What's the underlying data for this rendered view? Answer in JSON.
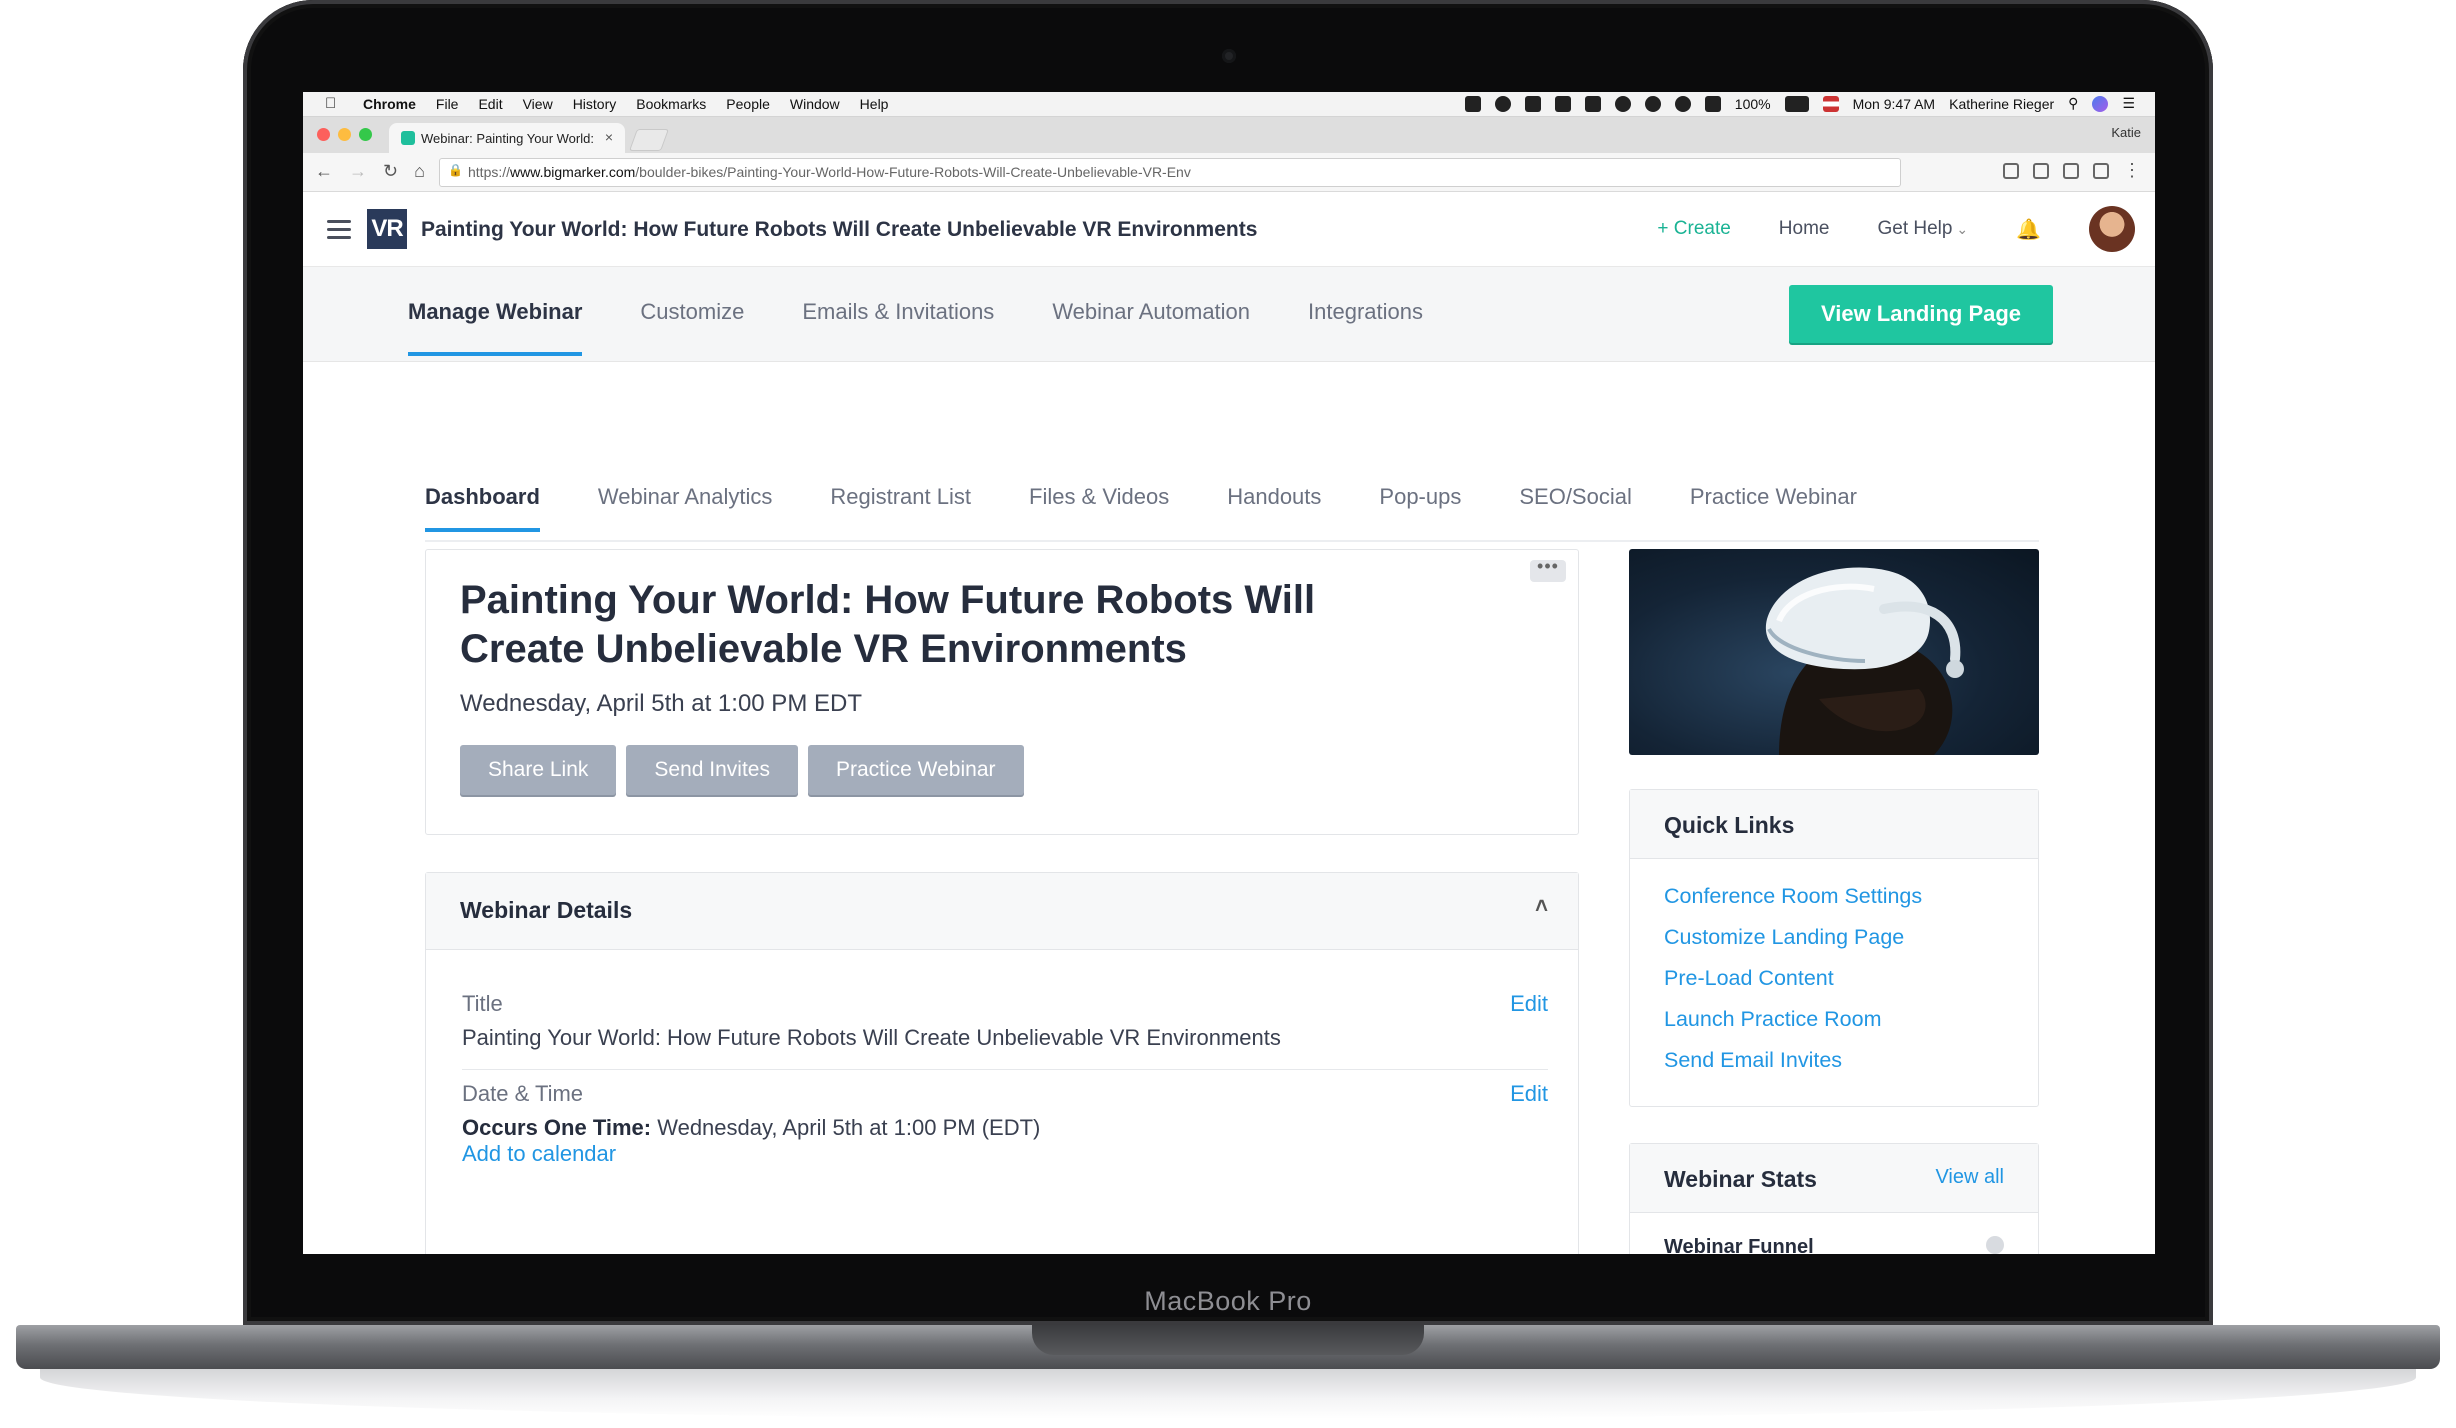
{
  "device": {
    "label": "MacBook Pro"
  },
  "menubar": {
    "items": [
      "Chrome",
      "File",
      "Edit",
      "View",
      "History",
      "Bookmarks",
      "People",
      "Window",
      "Help"
    ],
    "battery": "100%",
    "clock": "Mon 9:47 AM",
    "user": "Katherine Rieger"
  },
  "browser": {
    "tab_title": "Webinar: Painting Your World:",
    "tab_close": "×",
    "profile": "Katie",
    "url_scheme": "https://",
    "url_host": "www.bigmarker.com",
    "url_path": "/boulder-bikes/Painting-Your-World-How-Future-Robots-Will-Create-Unbelievable-VR-Env"
  },
  "header": {
    "logo_text": "VR",
    "title": "Painting Your World: How Future Robots Will Create Unbelievable VR Environments",
    "create": "+ Create",
    "home": "Home",
    "get_help": "Get Help"
  },
  "manage_nav": {
    "items": [
      "Manage Webinar",
      "Customize",
      "Emails & Invitations",
      "Webinar Automation",
      "Integrations"
    ],
    "view_landing": "View Landing Page"
  },
  "sub_tabs": [
    "Dashboard",
    "Webinar Analytics",
    "Registrant List",
    "Files & Videos",
    "Handouts",
    "Pop-ups",
    "SEO/Social",
    "Practice Webinar"
  ],
  "webinar_card": {
    "more": "•••",
    "title": "Painting Your World: How Future Robots Will Create Unbelievable VR Environments",
    "datetime": "Wednesday, April 5th at 1:00 PM EDT",
    "buttons": [
      "Share Link",
      "Send Invites",
      "Practice Webinar"
    ]
  },
  "details": {
    "heading": "Webinar Details",
    "collapse": "˄",
    "title_label": "Title",
    "title_value": "Painting Your World: How Future Robots Will Create Unbelievable VR Environments",
    "edit": "Edit",
    "date_label": "Date & Time",
    "occurs_label": "Occurs One Time:",
    "occurs_value": " Wednesday, April 5th at 1:00 PM (EDT)",
    "add_calendar": "Add to calendar"
  },
  "quick_links": {
    "heading": "Quick Links",
    "items": [
      "Conference Room Settings",
      "Customize Landing Page",
      "Pre-Load Content",
      "Launch Practice Room",
      "Send Email Invites"
    ]
  },
  "stats": {
    "heading": "Webinar Stats",
    "view_all": "View all",
    "funnel": "Webinar Funnel"
  },
  "colors": {
    "accent": "#2196e3",
    "brand_green": "#1fc6a0",
    "navy": "#2a3a5a",
    "button_gray": "#a4adbb"
  },
  "icons": [
    "apple-icon",
    "hamburger-icon",
    "bell-icon",
    "avatar",
    "ellipsis-icon",
    "chevron-up-icon",
    "info-icon",
    "lock-icon"
  ]
}
